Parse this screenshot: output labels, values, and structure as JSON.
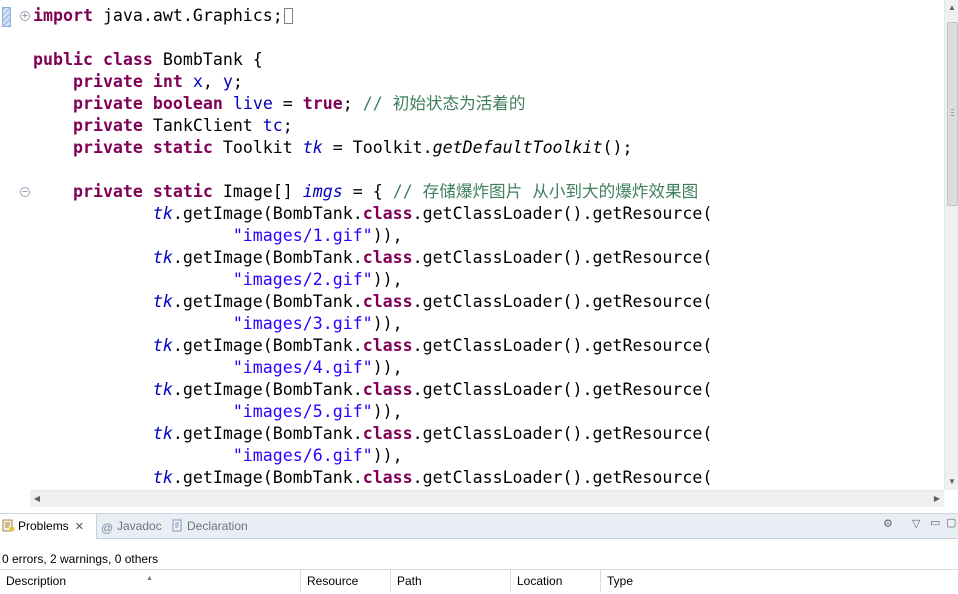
{
  "editor": {
    "lines": [
      [
        {
          "t": "import",
          "c": "kw"
        },
        {
          "t": " java.awt.Graphics;"
        }
      ],
      [],
      [
        {
          "t": "public",
          "c": "kw"
        },
        {
          "t": " "
        },
        {
          "t": "class",
          "c": "kw"
        },
        {
          "t": " BombTank {"
        }
      ],
      [
        {
          "t": "    "
        },
        {
          "t": "private",
          "c": "kw"
        },
        {
          "t": " "
        },
        {
          "t": "int",
          "c": "kw"
        },
        {
          "t": " "
        },
        {
          "t": "x",
          "c": "field"
        },
        {
          "t": ", "
        },
        {
          "t": "y",
          "c": "field"
        },
        {
          "t": ";"
        }
      ],
      [
        {
          "t": "    "
        },
        {
          "t": "private",
          "c": "kw"
        },
        {
          "t": " "
        },
        {
          "t": "boolean",
          "c": "kw"
        },
        {
          "t": " "
        },
        {
          "t": "live",
          "c": "field"
        },
        {
          "t": " = "
        },
        {
          "t": "true",
          "c": "kw"
        },
        {
          "t": "; "
        },
        {
          "t": "// 初始状态为活着的",
          "c": "cmt"
        }
      ],
      [
        {
          "t": "    "
        },
        {
          "t": "private",
          "c": "kw"
        },
        {
          "t": " TankClient "
        },
        {
          "t": "tc",
          "c": "field"
        },
        {
          "t": ";"
        }
      ],
      [
        {
          "t": "    "
        },
        {
          "t": "private",
          "c": "kw"
        },
        {
          "t": " "
        },
        {
          "t": "static",
          "c": "kw"
        },
        {
          "t": " Toolkit "
        },
        {
          "t": "tk",
          "c": "sfield"
        },
        {
          "t": " = Toolkit."
        },
        {
          "t": "getDefaultToolkit",
          "c": "smethod"
        },
        {
          "t": "();"
        }
      ],
      [],
      [
        {
          "t": "    "
        },
        {
          "t": "private",
          "c": "kw"
        },
        {
          "t": " "
        },
        {
          "t": "static",
          "c": "kw"
        },
        {
          "t": " Image[] "
        },
        {
          "t": "imgs",
          "c": "sfield"
        },
        {
          "t": " = { "
        },
        {
          "t": "// 存储爆炸图片 从小到大的爆炸效果图",
          "c": "cmt"
        }
      ],
      [
        {
          "t": "            "
        },
        {
          "t": "tk",
          "c": "sfield"
        },
        {
          "t": ".getImage(BombTank."
        },
        {
          "t": "class",
          "c": "kw"
        },
        {
          "t": ".getClassLoader().getResource("
        }
      ],
      [
        {
          "t": "                    "
        },
        {
          "t": "\"images/1.gif\"",
          "c": "str"
        },
        {
          "t": ")),"
        }
      ],
      [
        {
          "t": "            "
        },
        {
          "t": "tk",
          "c": "sfield"
        },
        {
          "t": ".getImage(BombTank."
        },
        {
          "t": "class",
          "c": "kw"
        },
        {
          "t": ".getClassLoader().getResource("
        }
      ],
      [
        {
          "t": "                    "
        },
        {
          "t": "\"images/2.gif\"",
          "c": "str"
        },
        {
          "t": ")),"
        }
      ],
      [
        {
          "t": "            "
        },
        {
          "t": "tk",
          "c": "sfield"
        },
        {
          "t": ".getImage(BombTank."
        },
        {
          "t": "class",
          "c": "kw"
        },
        {
          "t": ".getClassLoader().getResource("
        }
      ],
      [
        {
          "t": "                    "
        },
        {
          "t": "\"images/3.gif\"",
          "c": "str"
        },
        {
          "t": ")),"
        }
      ],
      [
        {
          "t": "            "
        },
        {
          "t": "tk",
          "c": "sfield"
        },
        {
          "t": ".getImage(BombTank."
        },
        {
          "t": "class",
          "c": "kw"
        },
        {
          "t": ".getClassLoader().getResource("
        }
      ],
      [
        {
          "t": "                    "
        },
        {
          "t": "\"images/4.gif\"",
          "c": "str"
        },
        {
          "t": ")),"
        }
      ],
      [
        {
          "t": "            "
        },
        {
          "t": "tk",
          "c": "sfield"
        },
        {
          "t": ".getImage(BombTank."
        },
        {
          "t": "class",
          "c": "kw"
        },
        {
          "t": ".getClassLoader().getResource("
        }
      ],
      [
        {
          "t": "                    "
        },
        {
          "t": "\"images/5.gif\"",
          "c": "str"
        },
        {
          "t": ")),"
        }
      ],
      [
        {
          "t": "            "
        },
        {
          "t": "tk",
          "c": "sfield"
        },
        {
          "t": ".getImage(BombTank."
        },
        {
          "t": "class",
          "c": "kw"
        },
        {
          "t": ".getClassLoader().getResource("
        }
      ],
      [
        {
          "t": "                    "
        },
        {
          "t": "\"images/6.gif\"",
          "c": "str"
        },
        {
          "t": ")),"
        }
      ],
      [
        {
          "t": "            "
        },
        {
          "t": "tk",
          "c": "sfield"
        },
        {
          "t": ".getImage(BombTank."
        },
        {
          "t": "class",
          "c": "kw"
        },
        {
          "t": ".getClassLoader().getResource("
        }
      ]
    ],
    "colors": {
      "keyword": "#7f0055",
      "field": "#0000c0",
      "comment": "#3f7f5f",
      "string": "#2a00ff"
    }
  },
  "problems_view": {
    "tabs": [
      {
        "label": "Problems",
        "icon": "problems-icon",
        "active": true
      },
      {
        "label": "Javadoc",
        "icon": "at-sign-icon",
        "active": false
      },
      {
        "label": "Declaration",
        "icon": "declaration-icon",
        "active": false
      }
    ],
    "summary": "0 errors, 2 warnings, 0 others",
    "columns": [
      "Description",
      "Resource",
      "Path",
      "Location",
      "Type"
    ]
  }
}
